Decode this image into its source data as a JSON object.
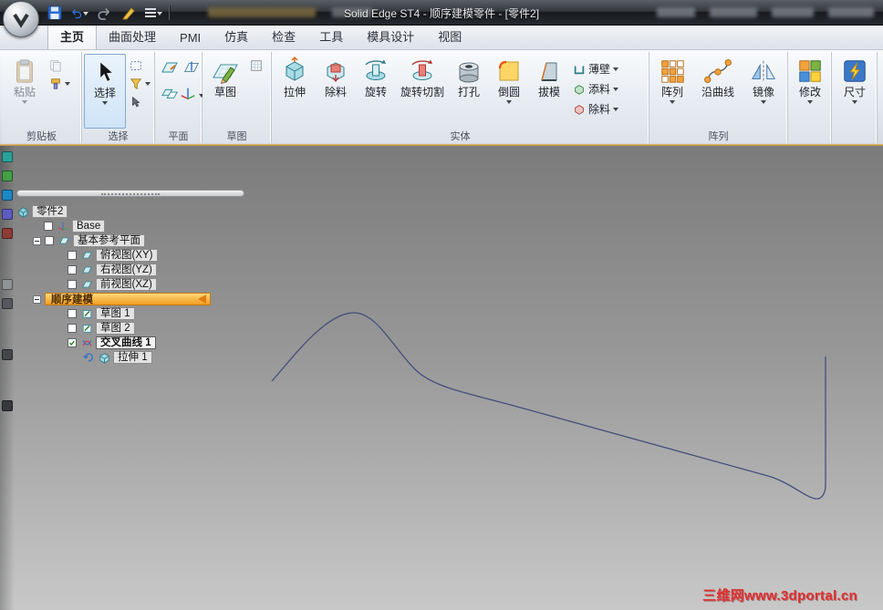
{
  "titlebar": {
    "title": "Solid Edge ST4 - 顺序建模零件 - [零件2]"
  },
  "tabs": [
    "主页",
    "曲面处理",
    "PMI",
    "仿真",
    "检查",
    "工具",
    "模具设计",
    "视图"
  ],
  "ribbon": {
    "groups": [
      {
        "label": "剪贴板",
        "buttons": [
          "粘贴"
        ]
      },
      {
        "label": "选择",
        "buttons": [
          "选择"
        ]
      },
      {
        "label": "平面",
        "buttons": []
      },
      {
        "label": "草图",
        "buttons": [
          "草图"
        ]
      },
      {
        "label": "实体",
        "buttons": [
          "拉伸",
          "除料",
          "旋转",
          "旋转切割",
          "打孔",
          "倒圆",
          "拔模"
        ],
        "flyouts": [
          "薄壁",
          "添料",
          "除料"
        ]
      },
      {
        "label": "阵列",
        "buttons": [
          "阵列",
          "沿曲线",
          "镜像"
        ]
      },
      {
        "label": "",
        "buttons": [
          "修改"
        ]
      },
      {
        "label": "",
        "buttons": [
          "尺寸"
        ]
      }
    ]
  },
  "tree": {
    "root_label": "零件2",
    "items": [
      "Base",
      "基本参考平面",
      "俯视图(XY)",
      "右视图(YZ)",
      "前视图(XZ)",
      "顺序建模",
      "草图 1",
      "草图 2",
      "交叉曲线 1",
      "拉伸 1"
    ]
  },
  "watermark": {
    "text": "三维网www.3dportal.cn"
  },
  "colors": {
    "tree_highlight_start": "#ffd97a",
    "tree_highlight_end": "#f29c20",
    "watermark_red": "#e03131",
    "curve_stroke": "#3c4977",
    "ribbon_accent": "#b5893f"
  }
}
